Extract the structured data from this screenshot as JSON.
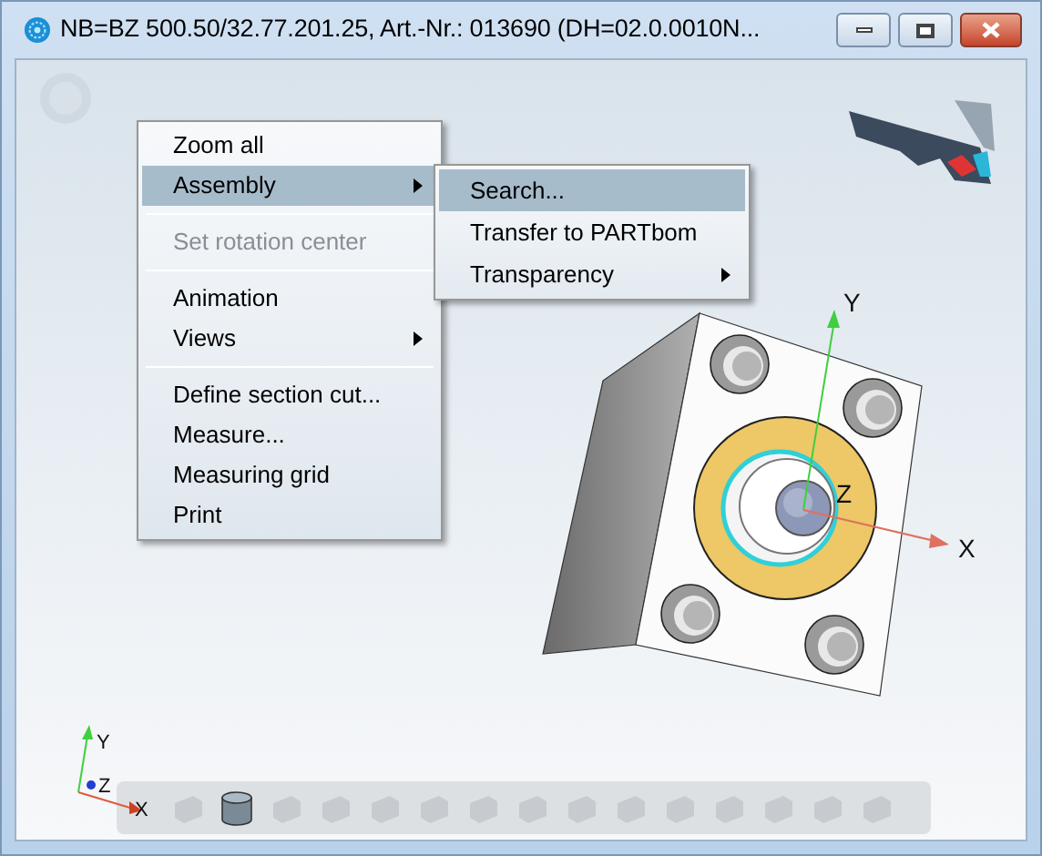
{
  "window": {
    "title": "NB=BZ 500.50/32.77.201.25, Art.-Nr.: 013690 (DH=02.0.0010N..."
  },
  "context_menu": {
    "items": [
      {
        "kind": "item",
        "label": "Zoom all",
        "selected": false,
        "disabled": false,
        "submenu": false
      },
      {
        "kind": "item",
        "label": "Assembly",
        "selected": true,
        "disabled": false,
        "submenu": true
      },
      {
        "kind": "separator"
      },
      {
        "kind": "item",
        "label": "Set rotation center",
        "selected": false,
        "disabled": true,
        "submenu": false
      },
      {
        "kind": "separator"
      },
      {
        "kind": "item",
        "label": "Animation",
        "selected": false,
        "disabled": false,
        "submenu": false
      },
      {
        "kind": "item",
        "label": "Views",
        "selected": false,
        "disabled": false,
        "submenu": true
      },
      {
        "kind": "separator"
      },
      {
        "kind": "item",
        "label": "Define section cut...",
        "selected": false,
        "disabled": false,
        "submenu": false
      },
      {
        "kind": "item",
        "label": "Measure...",
        "selected": false,
        "disabled": false,
        "submenu": false
      },
      {
        "kind": "item",
        "label": "Measuring grid",
        "selected": false,
        "disabled": false,
        "submenu": false
      },
      {
        "kind": "item",
        "label": "Print",
        "selected": false,
        "disabled": false,
        "submenu": false
      }
    ]
  },
  "submenu": {
    "items": [
      {
        "label": "Search...",
        "selected": true,
        "submenu": false
      },
      {
        "label": "Transfer to PARTbom",
        "selected": false,
        "submenu": false
      },
      {
        "label": "Transparency",
        "selected": false,
        "submenu": true
      }
    ]
  },
  "model_axes": {
    "x": "X",
    "y": "Y",
    "z": "Z"
  },
  "triad_axes": {
    "x": "X",
    "y": "Y",
    "z": "Z"
  },
  "toolbar": {
    "buttons": [
      {
        "disabled": true
      },
      {
        "disabled": false
      },
      {
        "disabled": true
      },
      {
        "disabled": true
      },
      {
        "disabled": true
      },
      {
        "disabled": true
      },
      {
        "disabled": true
      },
      {
        "disabled": true
      },
      {
        "disabled": true
      },
      {
        "disabled": true
      },
      {
        "disabled": true
      },
      {
        "disabled": true
      },
      {
        "disabled": true
      },
      {
        "disabled": true
      },
      {
        "disabled": true
      }
    ]
  }
}
